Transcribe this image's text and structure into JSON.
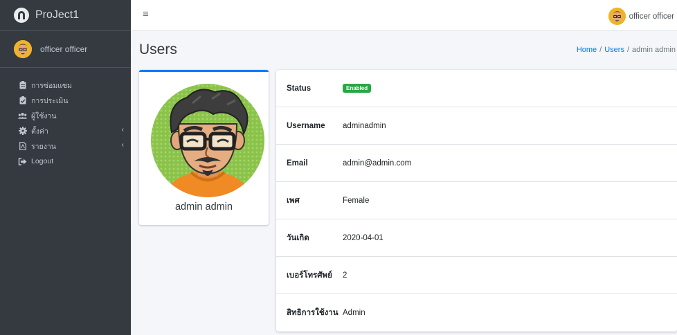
{
  "brand": {
    "name": "ProJect1"
  },
  "sidebar_user": {
    "name": "officer officer"
  },
  "nav": [
    {
      "label": "การซ่อมแซม",
      "icon": "clipboard-icon",
      "caret": ""
    },
    {
      "label": "การประเมิน",
      "icon": "checklist-icon",
      "caret": ""
    },
    {
      "label": "ผู้ใช้งาน",
      "icon": "users-icon",
      "caret": ""
    },
    {
      "label": "ตั้งค่า",
      "icon": "gear-icon",
      "caret": "‹"
    },
    {
      "label": "รายงาน",
      "icon": "report-icon",
      "caret": "‹"
    },
    {
      "label": "Logout",
      "icon": "logout-icon",
      "caret": ""
    }
  ],
  "topbar": {
    "menu_glyph": "≡",
    "user_name": "officer officer"
  },
  "page": {
    "title": "Users"
  },
  "breadcrumb": {
    "home": "Home",
    "users": "Users",
    "current": "admin admin",
    "separator": "/"
  },
  "profile": {
    "name": "admin admin"
  },
  "details": [
    {
      "label": "Status",
      "value": "Enabled",
      "type": "badge"
    },
    {
      "label": "Username",
      "value": "adminadmin"
    },
    {
      "label": "Email",
      "value": "admin@admin.com"
    },
    {
      "label": "เพศ",
      "value": "Female"
    },
    {
      "label": "วันเกิด",
      "value": "2020-04-01"
    },
    {
      "label": "เบอร์โทรศัพย์",
      "value": "2"
    },
    {
      "label": "สิทธิการใช้งาน",
      "value": "Admin"
    }
  ],
  "colors": {
    "sidebar": "#343a40",
    "link": "#007bff",
    "badge": "#28a745",
    "card_accent": "#007bff"
  }
}
